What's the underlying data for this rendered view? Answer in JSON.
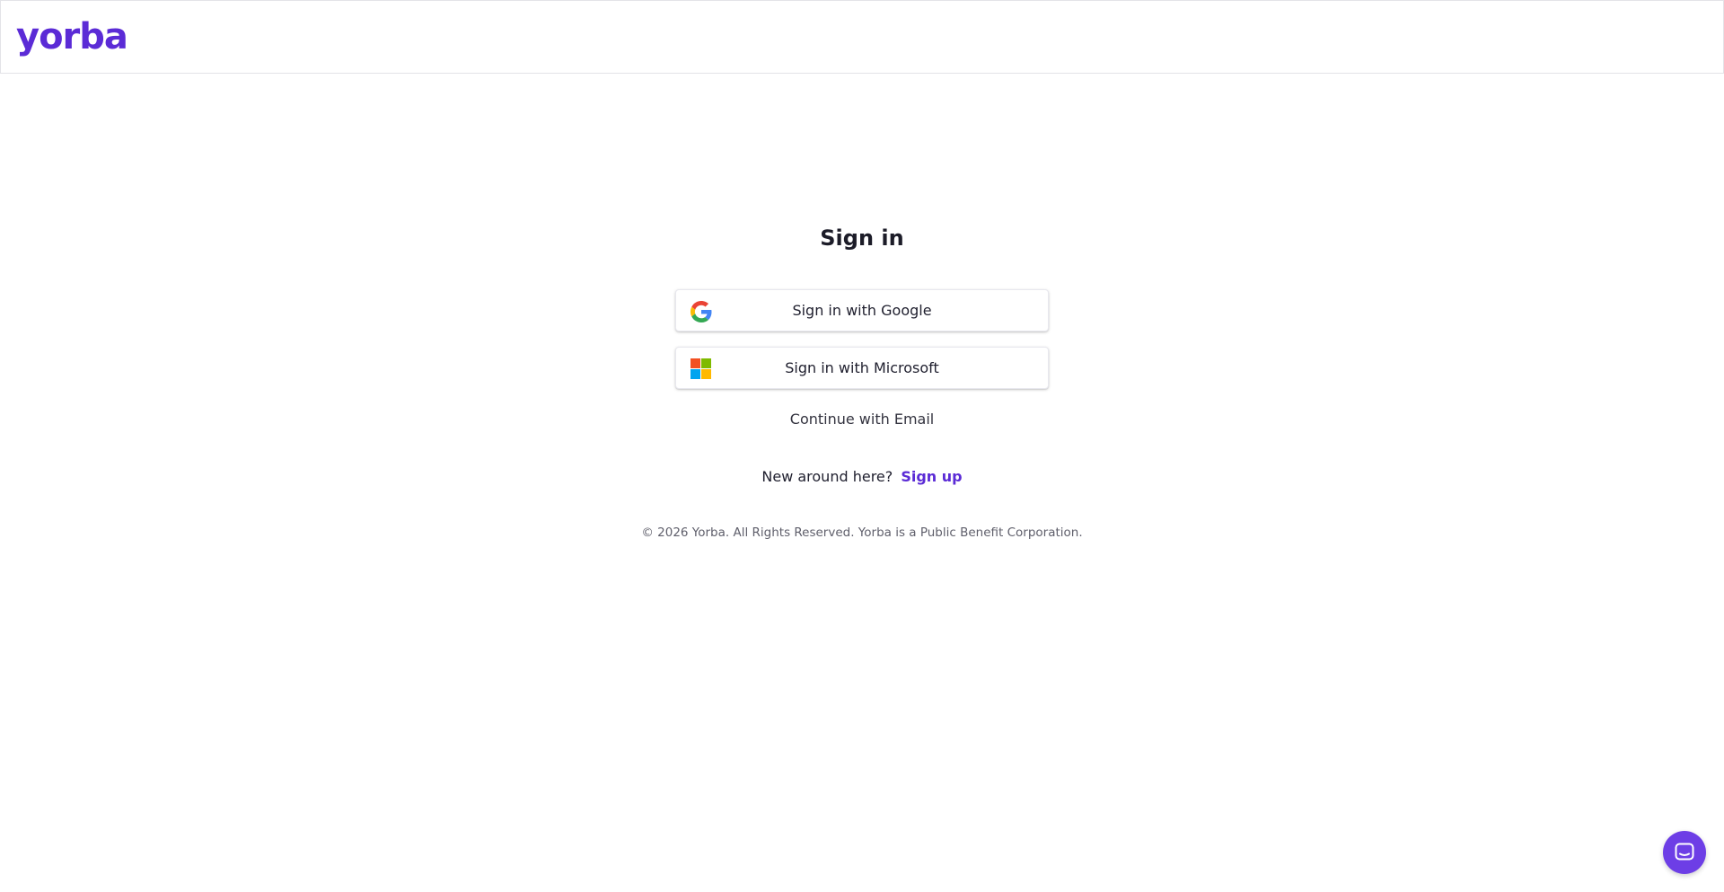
{
  "header": {
    "logo_text": "yorba"
  },
  "signin": {
    "title": "Sign in",
    "google_label": "Sign in with Google",
    "google_icon": "google-icon",
    "microsoft_label": "Sign in with Microsoft",
    "microsoft_icon": "microsoft-icon",
    "email_label": "Continue with Email",
    "new_prompt": "New around here?",
    "signup_label": "Sign up"
  },
  "footer": {
    "copyright": "© 2026 Yorba. All Rights Reserved. Yorba is a Public Benefit Corporation."
  },
  "chat": {
    "icon": "chat-icon"
  },
  "colors": {
    "brand": "#5b2bd6",
    "chat_launcher": "#6d3ee6",
    "google_blue": "#4285F4",
    "google_green": "#34A853",
    "google_yellow": "#FBBC05",
    "google_red": "#EA4335",
    "ms_red": "#F25022",
    "ms_green": "#7FBA00",
    "ms_blue": "#00A4EF",
    "ms_yellow": "#FFB900"
  }
}
